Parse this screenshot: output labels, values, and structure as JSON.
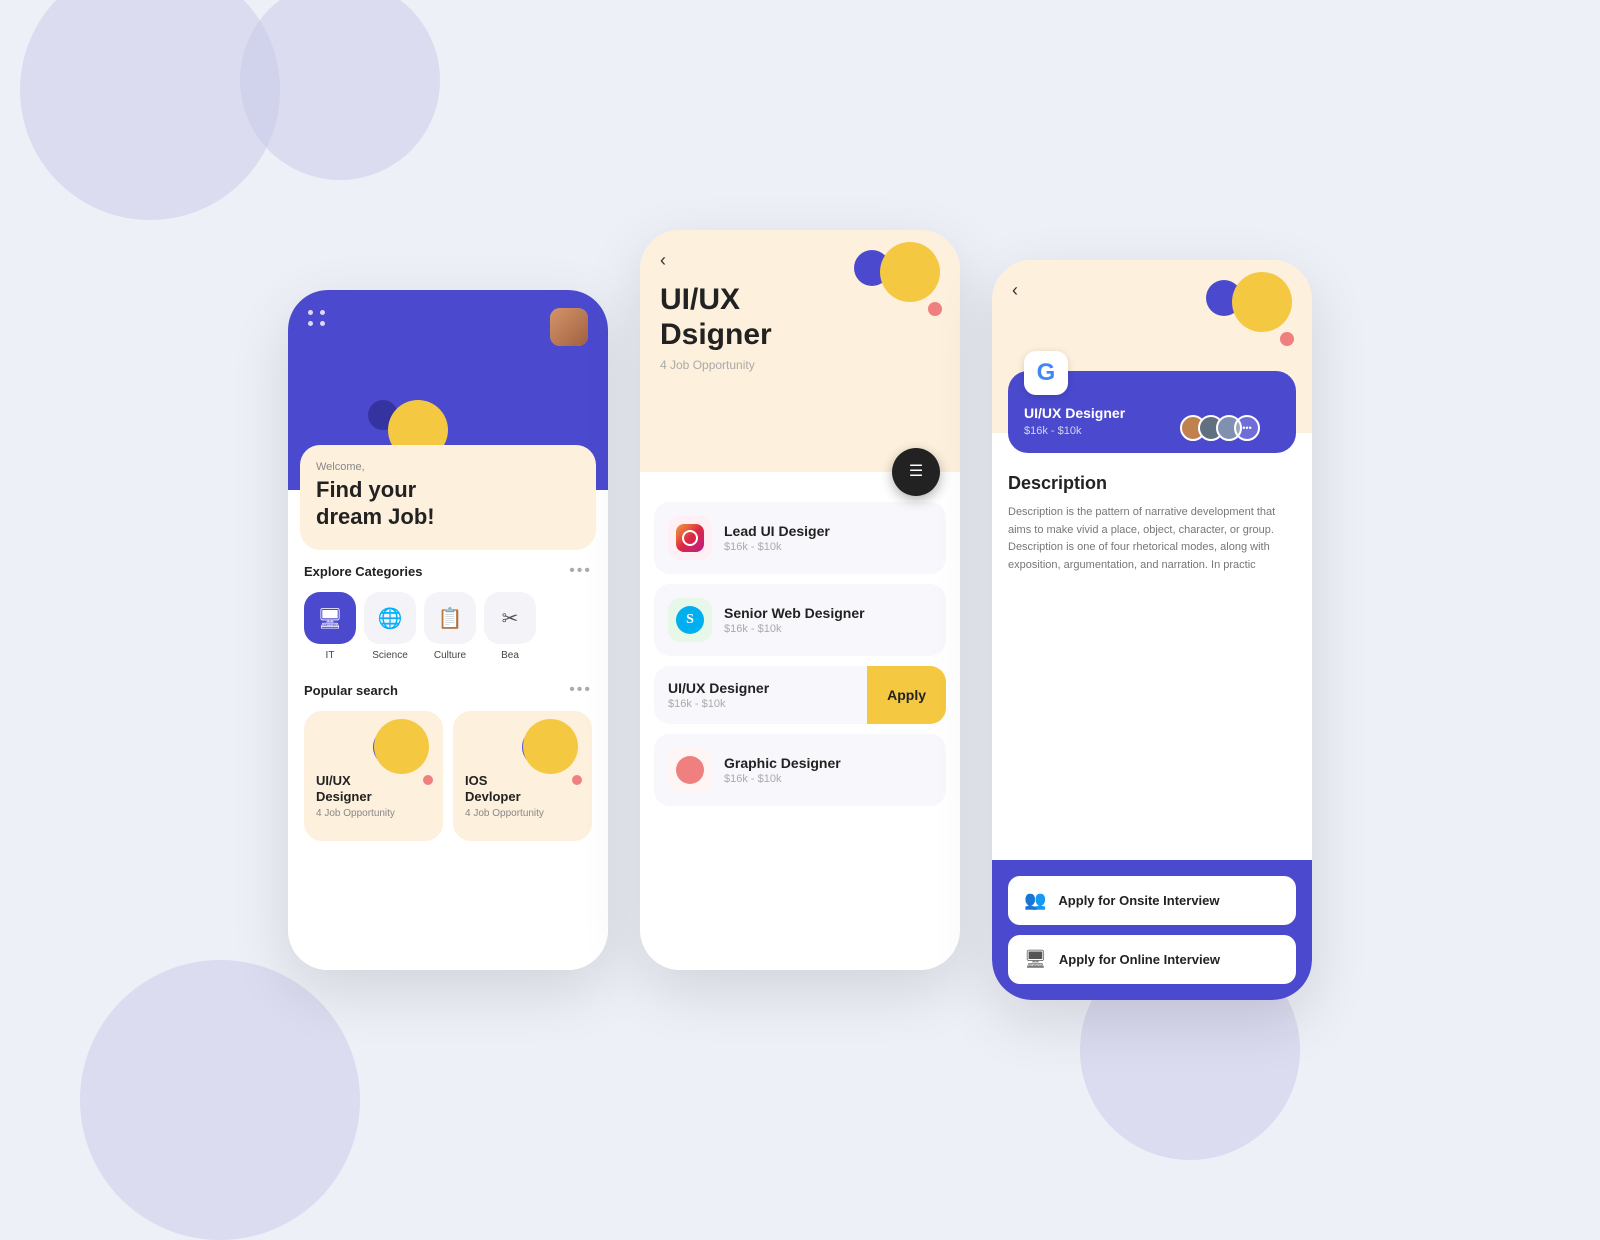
{
  "background": {
    "color": "#eef0f8"
  },
  "phone1": {
    "welcome": "Welcome,",
    "tagline1": "Find your",
    "tagline2": "dream Job!",
    "section_categories": "Explore Categories",
    "section_popular": "Popular search",
    "categories": [
      {
        "label": "IT",
        "icon": "🖥"
      },
      {
        "label": "Science",
        "icon": "🌐"
      },
      {
        "label": "Culture",
        "icon": "📋"
      },
      {
        "label": "Bea",
        "icon": "✂"
      }
    ],
    "popular_cards": [
      {
        "title1": "UI/UX",
        "title2": "Designer",
        "sub": "4 Job Opportunity"
      },
      {
        "title1": "IOS",
        "title2": "Devloper",
        "sub": "4 Job Opportunity"
      }
    ]
  },
  "phone2": {
    "back": "‹",
    "title1": "UI/UX",
    "title2": "Dsigner",
    "subtitle": "4 Job Opportunity",
    "jobs": [
      {
        "title": "Lead UI Desiger",
        "salary": "$16k - $10k",
        "icon_type": "instagram"
      },
      {
        "title": "Senior Web Designer",
        "salary": "$16k - $10k",
        "icon_type": "skype"
      },
      {
        "title": "UI/UX Designer",
        "salary": "$16k - $10k",
        "apply_label": "Apply",
        "featured": true
      },
      {
        "title": "Graphic Designer",
        "salary": "$16k - $10k",
        "icon_type": "circle_pink"
      }
    ]
  },
  "phone3": {
    "back": "‹",
    "google_card": {
      "title": "UI/UX Designer",
      "salary": "$16k - $10k"
    },
    "description_title": "Description",
    "description_text": "Description is the pattern of narrative development that aims to make vivid a place, object, character, or group. Description is one of four rhetorical modes, along with exposition, argumentation, and narration. In practic",
    "apply_buttons": [
      {
        "label": "Apply for Onsite Interview",
        "icon": "👥"
      },
      {
        "label": "Apply for Online Interview",
        "icon": "🖥"
      }
    ]
  }
}
